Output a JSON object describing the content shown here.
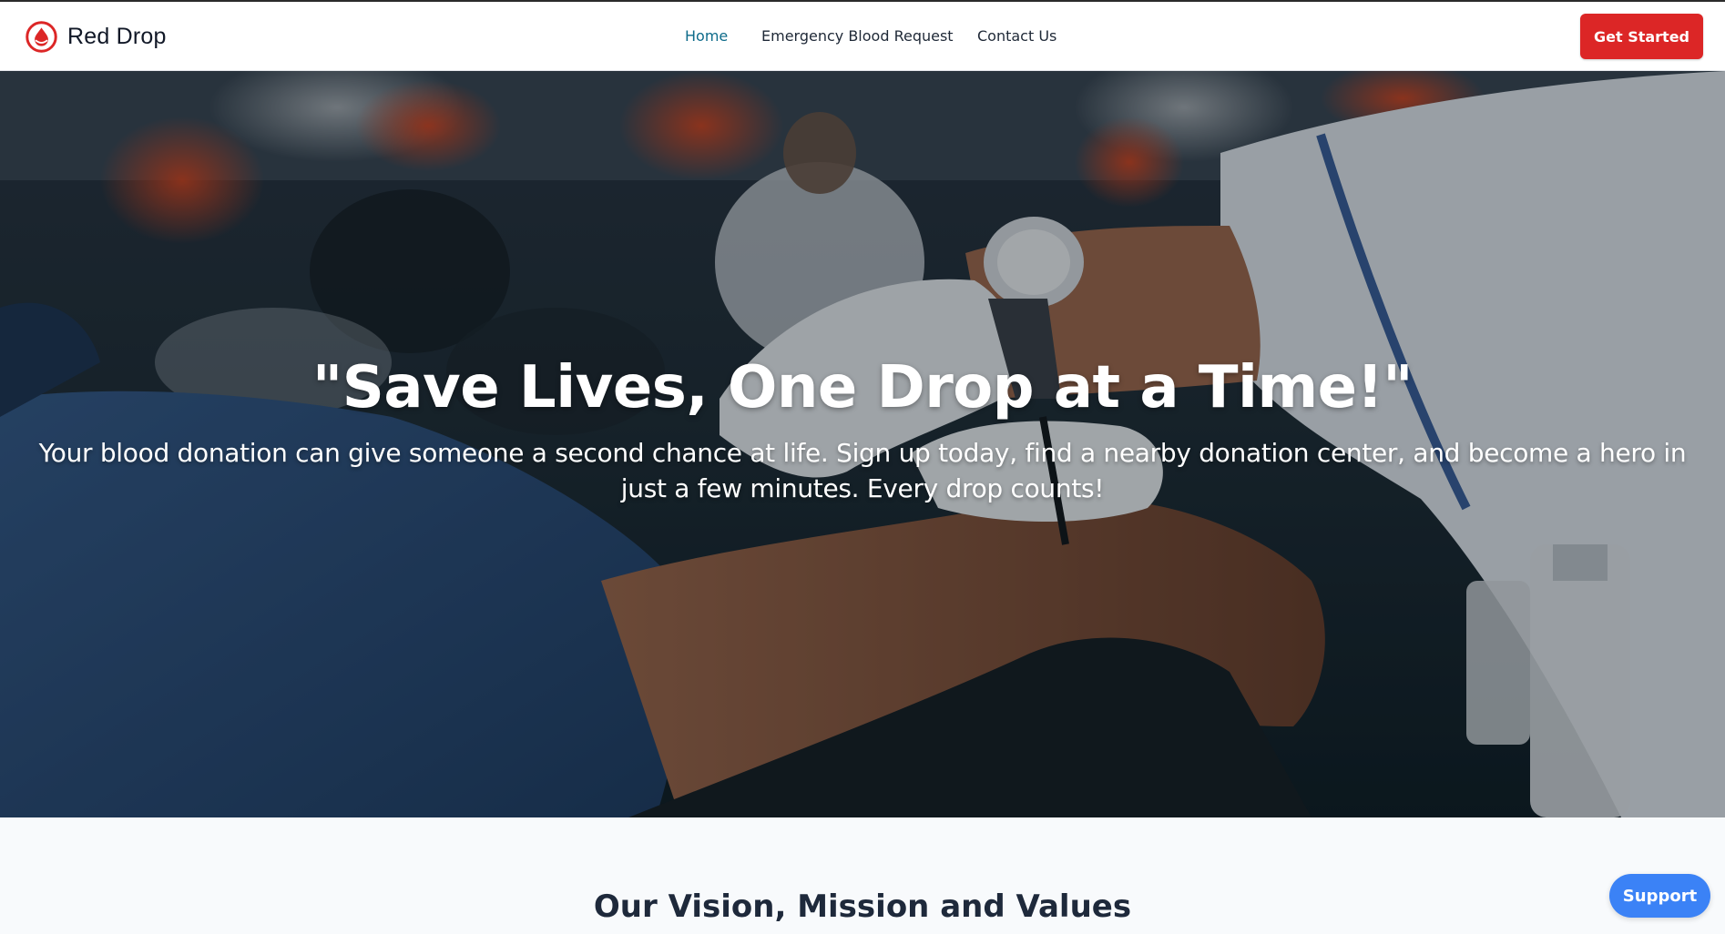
{
  "brand": {
    "name": "Red Drop",
    "logo_icon": "red-drop-logo-icon"
  },
  "nav": {
    "items": [
      {
        "label": "Home",
        "active": true
      },
      {
        "label": "Emergency Blood Request",
        "active": false
      },
      {
        "label": "Contact Us",
        "active": false
      }
    ],
    "cta_label": "Get Started"
  },
  "hero": {
    "title": "\"Save Lives, One Drop at a Time!\"",
    "subtitle": "Your blood donation can give someone a second chance at life. Sign up today, find a nearby donation center, and become a hero in just a few minutes. Every drop counts!",
    "image": "blood-donation-photo"
  },
  "vision": {
    "title": "Our Vision, Mission and Values"
  },
  "support": {
    "label": "Support"
  },
  "colors": {
    "brand_red": "#dc2626",
    "nav_active": "#0e6b8a",
    "support_blue": "#3b82f6",
    "heading_dark": "#1e293b"
  }
}
